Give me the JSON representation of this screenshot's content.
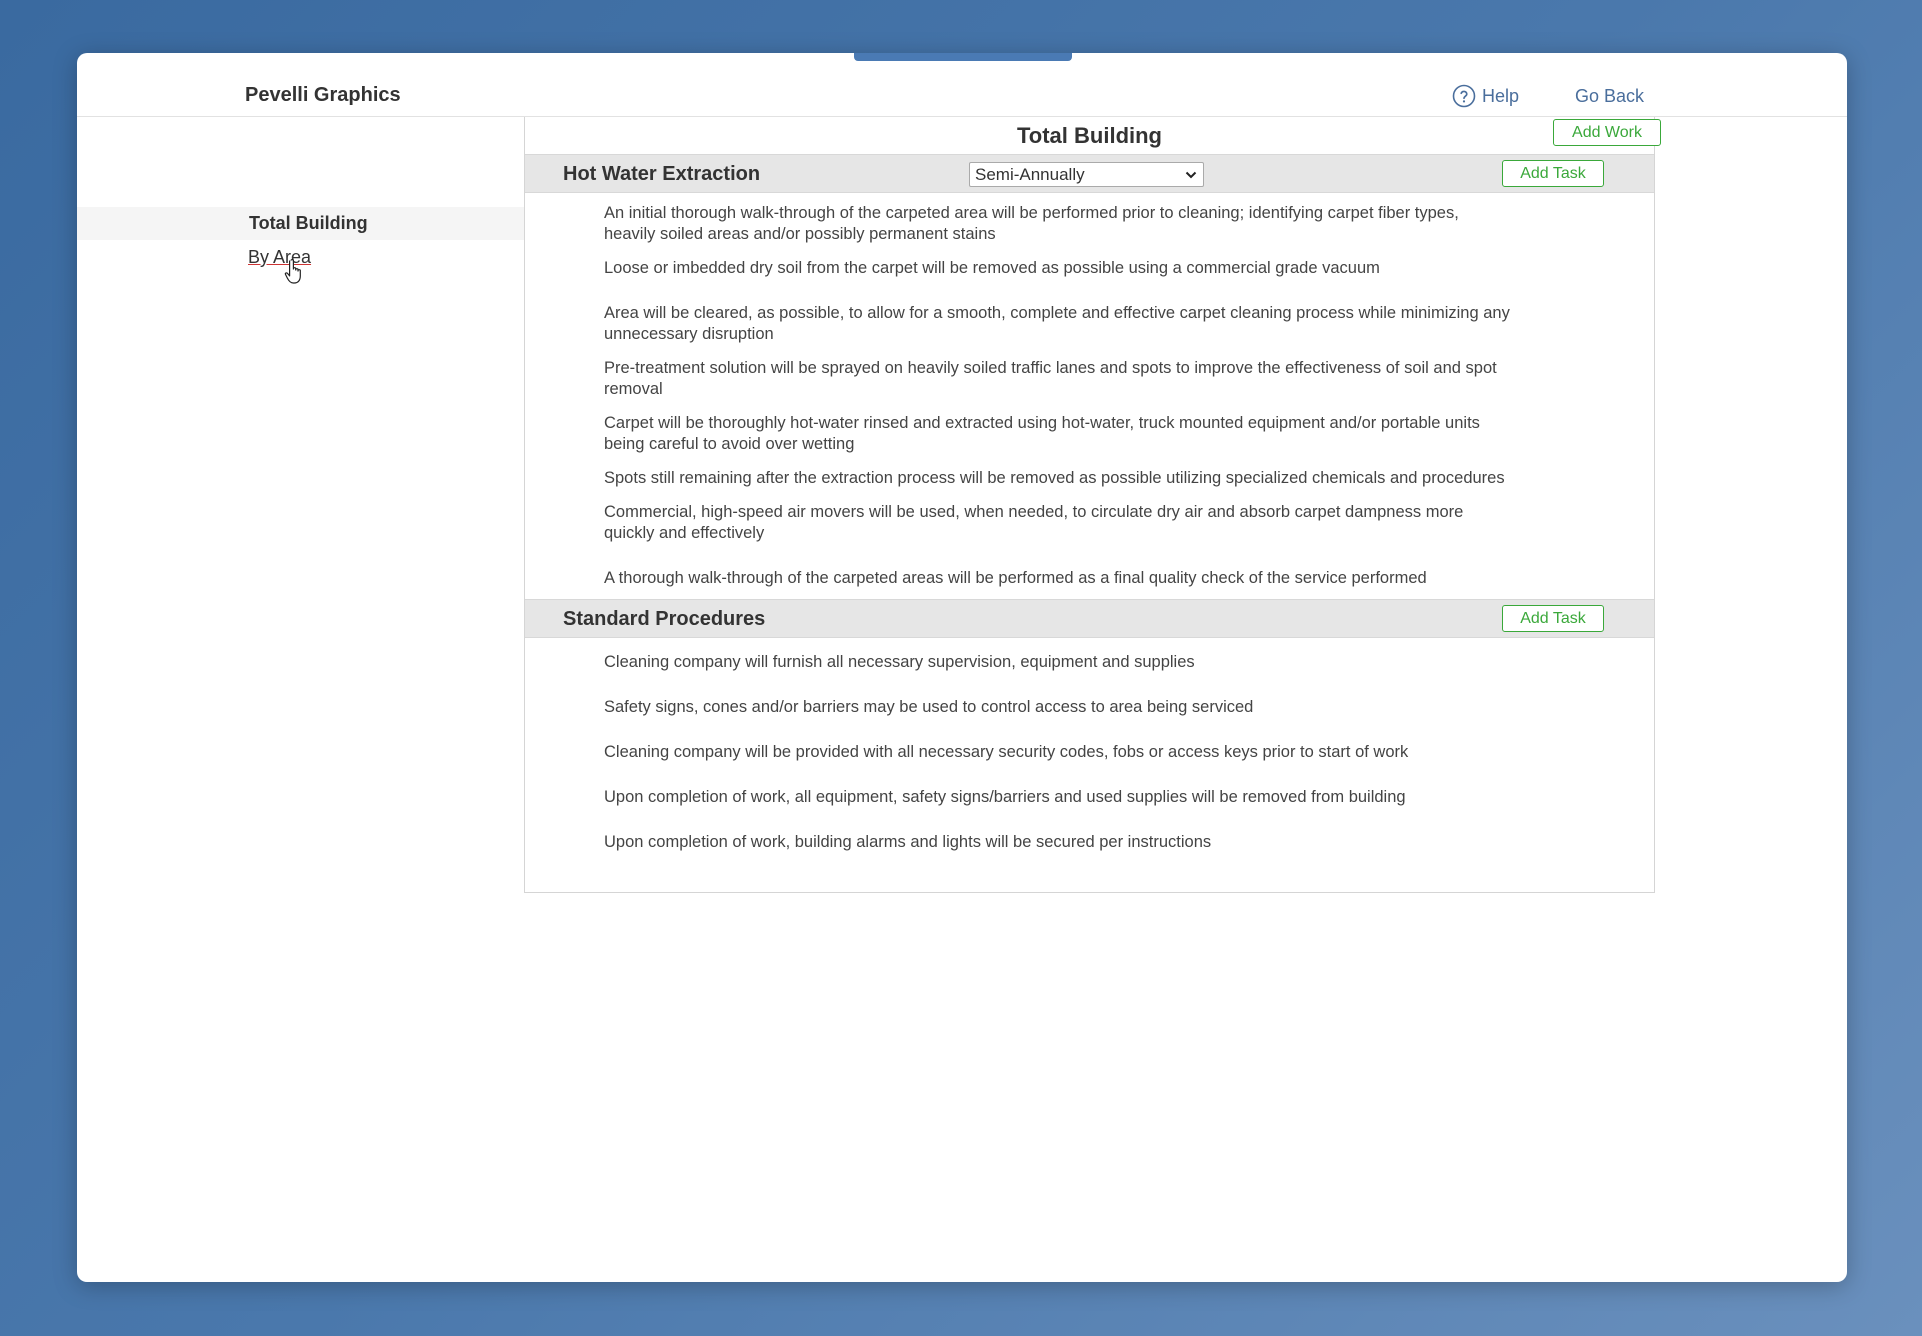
{
  "app": {
    "brand": "Pevelli Graphics",
    "help_label": "Help",
    "goback_label": "Go Back"
  },
  "sidebar": {
    "items": [
      {
        "label": "Total Building"
      },
      {
        "label": "By Area"
      }
    ]
  },
  "main": {
    "title": "Total Building",
    "add_work_label": "Add Work",
    "sections": [
      {
        "title": "Hot Water Extraction",
        "frequency": "Semi-Annually",
        "add_task_label": "Add Task",
        "tasks": [
          "An initial thorough walk-through of the carpeted area will be performed prior to cleaning; identifying carpet fiber types, heavily soiled areas and/or possibly permanent stains",
          "Loose or imbedded dry soil from the carpet will be removed as possible using a commercial grade vacuum",
          "Area will be cleared, as possible, to allow for a smooth, complete and effective carpet cleaning process while minimizing any unnecessary disruption",
          "Pre-treatment solution will be sprayed on heavily soiled traffic lanes and spots to improve the effectiveness of soil and spot removal",
          "Carpet will be thoroughly hot-water rinsed and extracted using hot-water, truck mounted equipment and/or portable units being careful to avoid over wetting",
          "Spots still remaining after the extraction process will be removed as possible utilizing specialized chemicals and procedures",
          "Commercial, high-speed air movers will be used, when needed, to circulate dry air and absorb carpet dampness more quickly and effectively",
          "A thorough walk-through of the carpeted areas will be performed as a final quality check of the service performed"
        ]
      },
      {
        "title": "Standard Procedures",
        "add_task_label": "Add Task",
        "tasks": [
          "Cleaning company will furnish all necessary supervision, equipment and supplies",
          "Safety signs, cones and/or barriers may be used to control access to area being serviced",
          "Cleaning company will be provided with all necessary security codes, fobs or access keys prior to start of work",
          "Upon completion of work, all equipment, safety signs/barriers and used supplies will be removed from building",
          "Upon completion of work, building alarms and lights will be secured per instructions"
        ]
      }
    ]
  },
  "colors": {
    "background": "#3a6aa0",
    "accent_green": "#3aa83a",
    "link_blue": "#4a6e9c",
    "section_bg": "#e6e6e6"
  },
  "icons": {
    "help": "help-circle-icon",
    "cursor": "hand-pointer-icon",
    "select": "chevron-down-icon"
  }
}
